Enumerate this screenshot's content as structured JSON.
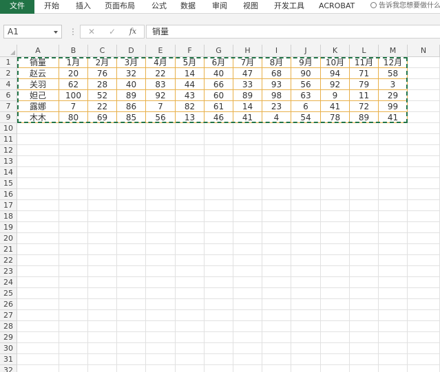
{
  "ribbon": {
    "tabs": [
      {
        "label": "文件",
        "name": "tab-file",
        "active": true
      },
      {
        "label": "开始",
        "name": "tab-home"
      },
      {
        "label": "插入",
        "name": "tab-insert"
      },
      {
        "label": "页面布局",
        "name": "tab-page-layout"
      },
      {
        "label": "公式",
        "name": "tab-formulas"
      },
      {
        "label": "数据",
        "name": "tab-data"
      },
      {
        "label": "审阅",
        "name": "tab-review"
      },
      {
        "label": "视图",
        "name": "tab-view"
      },
      {
        "label": "开发工具",
        "name": "tab-developer"
      },
      {
        "label": "ACROBAT",
        "name": "tab-acrobat"
      }
    ],
    "tell_me": "告诉我您想要做什么"
  },
  "formula_bar": {
    "name_box": "A1",
    "cancel_glyph": "✕",
    "enter_glyph": "✓",
    "fx_glyph": "fx",
    "content": "销量"
  },
  "sheet": {
    "columns": [
      "A",
      "B",
      "C",
      "D",
      "E",
      "F",
      "G",
      "H",
      "I",
      "J",
      "K",
      "L",
      "M",
      "N"
    ],
    "row_numbers": [
      "1",
      "2",
      "4",
      "6",
      "7",
      "9",
      "10",
      "11",
      "12",
      "13",
      "14",
      "15",
      "16",
      "17",
      "18",
      "19",
      "20",
      "21",
      "22",
      "23",
      "24",
      "25",
      "26",
      "27",
      "28",
      "29",
      "30",
      "31",
      "32"
    ],
    "header_row": [
      "销量",
      "1月",
      "2月",
      "3月",
      "4月",
      "5月",
      "6月",
      "7月",
      "8月",
      "9月",
      "10月",
      "11月",
      "12月"
    ],
    "rows": [
      [
        "赵云",
        "20",
        "76",
        "32",
        "22",
        "14",
        "40",
        "47",
        "68",
        "90",
        "94",
        "71",
        "58"
      ],
      [
        "关羽",
        "62",
        "28",
        "40",
        "83",
        "44",
        "66",
        "33",
        "93",
        "56",
        "92",
        "79",
        "3"
      ],
      [
        "妲己",
        "100",
        "52",
        "89",
        "92",
        "43",
        "60",
        "89",
        "98",
        "63",
        "9",
        "11",
        "29"
      ],
      [
        "露娜",
        "7",
        "22",
        "86",
        "7",
        "82",
        "61",
        "14",
        "23",
        "6",
        "41",
        "72",
        "99"
      ],
      [
        "木木",
        "80",
        "69",
        "85",
        "56",
        "13",
        "46",
        "41",
        "4",
        "54",
        "78",
        "89",
        "41"
      ]
    ],
    "accent_color": "#217346",
    "grid_color": "#e1e1e1",
    "data_border_color": "#e8b04a"
  }
}
